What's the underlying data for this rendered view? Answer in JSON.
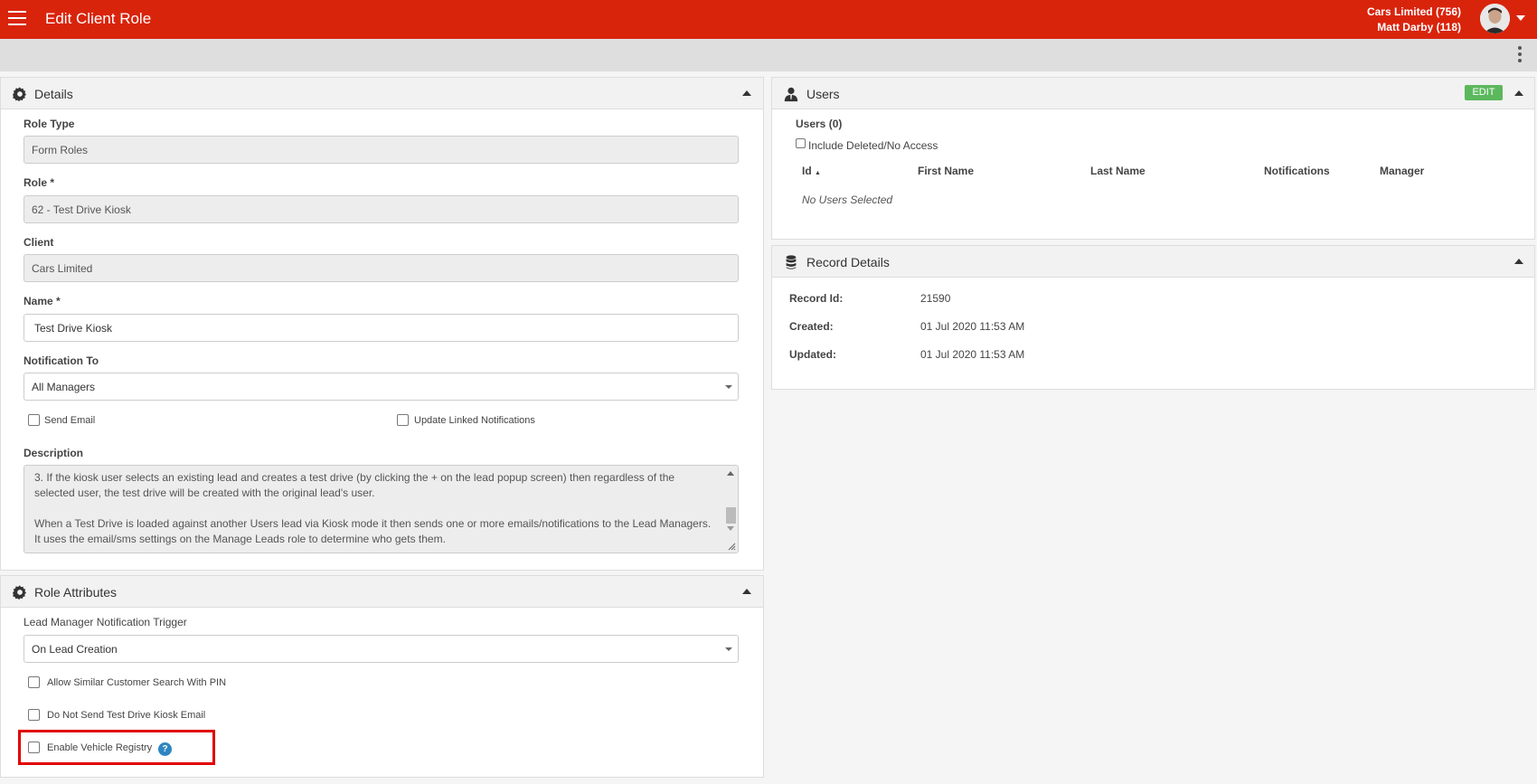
{
  "header": {
    "title": "Edit Client Role",
    "client": "Cars Limited (756)",
    "user": "Matt Darby (118)"
  },
  "details": {
    "title": "Details",
    "role_type_label": "Role Type",
    "role_type_value": "Form Roles",
    "role_label": "Role *",
    "role_value": "62 - Test Drive Kiosk",
    "client_label": "Client",
    "client_value": "Cars Limited",
    "name_label": "Name *",
    "name_value": "Test Drive Kiosk",
    "notification_label": "Notification To",
    "notification_value": "All Managers",
    "send_email_label": "Send Email",
    "update_linked_label": "Update Linked Notifications",
    "description_label": "Description",
    "description_p1": "3.      If the kiosk user selects an existing lead and creates a test drive (by clicking the + on the lead popup screen) then regardless of the selected user, the test drive will be created with the original lead's user.",
    "description_p2": "When a Test Drive is loaded against another Users lead via Kiosk mode it then sends one or more emails/notifications to the Lead Managers.  It uses the email/sms settings on the Manage Leads role to determine who gets them."
  },
  "role_attributes": {
    "title": "Role Attributes",
    "trigger_label": "Lead Manager Notification Trigger",
    "trigger_value": "On Lead Creation",
    "opt1_label": "Allow Similar Customer Search With PIN",
    "opt2_label": "Do Not Send Test Drive Kiosk Email",
    "opt3_label": "Enable Vehicle Registry",
    "help_glyph": "?"
  },
  "users": {
    "title": "Users",
    "edit_label": "EDIT",
    "count_label": "Users (0)",
    "include_deleted_label": "Include Deleted/No Access",
    "columns": [
      "Id",
      "First Name",
      "Last Name",
      "Notifications",
      "Manager"
    ],
    "sort_indicator": "▲",
    "empty_text": "No Users Selected"
  },
  "record_details": {
    "title": "Record Details",
    "record_id_label": "Record Id:",
    "record_id_value": "21590",
    "created_label": "Created:",
    "created_value": "01 Jul 2020 11:53 AM",
    "updated_label": "Updated:",
    "updated_value": "01 Jul 2020 11:53 AM"
  },
  "colors": {
    "brand": "#d9240c",
    "edit_button": "#5cb85c",
    "help_icon": "#2e86c1",
    "highlight": "#e00000"
  },
  "icons": [
    "menu-icon",
    "user-avatar",
    "more-vertical-icon",
    "gear-icon",
    "user-tie-icon",
    "database-icon",
    "help-icon"
  ]
}
